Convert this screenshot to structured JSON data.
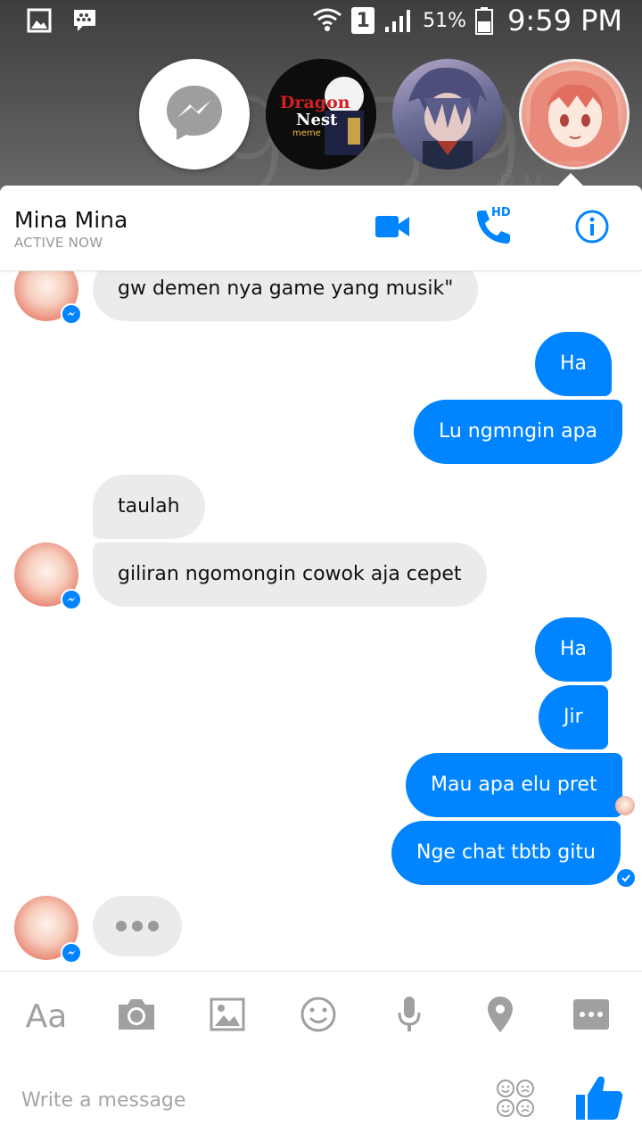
{
  "status_bar": {
    "signal_badge": "1",
    "battery": "51%",
    "time": "9:59 PM"
  },
  "wallpaper": {
    "clock_time": "9:59",
    "clock_suffix": "PM"
  },
  "chat_heads": [
    {
      "name": "messenger-launcher"
    },
    {
      "name": "dragon-nest-meme",
      "label_line1": "Dragon",
      "label_line2": "Nest",
      "label_line3": "meme"
    },
    {
      "name": "anime-boy-contact"
    },
    {
      "name": "mina-mina-contact"
    }
  ],
  "header": {
    "contact_name": "Mina Mina",
    "status": "ACTIVE NOW",
    "hd_label": "HD"
  },
  "messages": [
    {
      "from": "them",
      "text": "gw demen nya game yang musik\""
    },
    {
      "from": "me",
      "text": "Ha"
    },
    {
      "from": "me",
      "text": "Lu ngmngin apa"
    },
    {
      "from": "them",
      "text": "taulah"
    },
    {
      "from": "them",
      "text": "giliran ngomongin cowok aja cepet"
    },
    {
      "from": "me",
      "text": "Ha"
    },
    {
      "from": "me",
      "text": "Jir"
    },
    {
      "from": "me",
      "text": "Mau apa elu pret"
    },
    {
      "from": "me",
      "text": "Nge chat tbtb gitu"
    }
  ],
  "composer": {
    "text_tool_label": "Aa",
    "placeholder": "Write a message",
    "tools": [
      "text-tool",
      "camera-icon",
      "image-icon",
      "emoji-icon",
      "microphone-icon",
      "location-icon",
      "more-icon"
    ]
  },
  "colors": {
    "accent": "#0084ff",
    "incoming_bubble": "#ebebeb",
    "outgoing_bubble": "#0084ff"
  }
}
